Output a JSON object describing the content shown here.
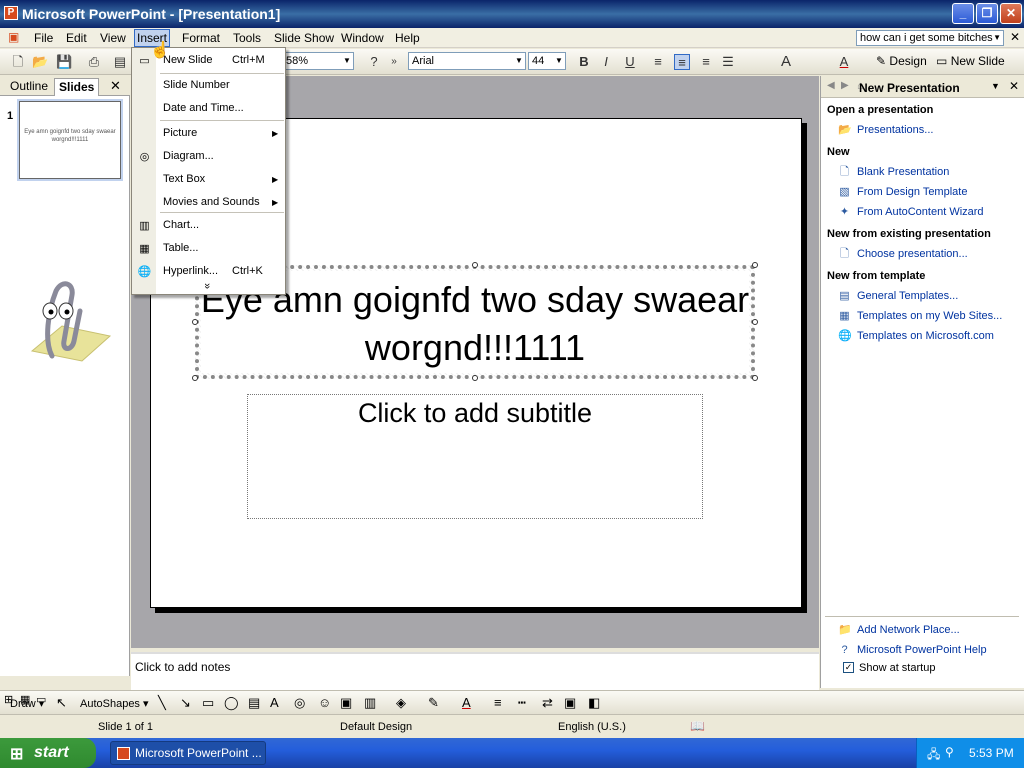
{
  "window": {
    "title": "Microsoft PowerPoint - [Presentation1]",
    "app_icon": "powerpoint-icon"
  },
  "menubar": {
    "items": [
      "File",
      "Edit",
      "View",
      "Insert",
      "Format",
      "Tools",
      "Slide Show",
      "Window",
      "Help"
    ],
    "ask_placeholder": "how can i get some bitches"
  },
  "toolbar": {
    "zoom": "58%",
    "font": "Arial",
    "font_size": "44",
    "design_label": "Design",
    "new_slide_label": "New Slide"
  },
  "insert_menu": {
    "items": [
      {
        "label": "New Slide",
        "shortcut": "Ctrl+M",
        "icon": "new-slide-icon",
        "submenu": false
      },
      {
        "label": "Slide Number",
        "shortcut": "",
        "icon": "",
        "submenu": false
      },
      {
        "label": "Date and Time...",
        "shortcut": "",
        "icon": "",
        "submenu": false
      },
      {
        "label": "Picture",
        "shortcut": "",
        "icon": "",
        "submenu": true
      },
      {
        "label": "Diagram...",
        "shortcut": "",
        "icon": "diagram-icon",
        "submenu": false
      },
      {
        "label": "Text Box",
        "shortcut": "",
        "icon": "",
        "submenu": true
      },
      {
        "label": "Movies and Sounds",
        "shortcut": "",
        "icon": "",
        "submenu": true
      },
      {
        "label": "Chart...",
        "shortcut": "",
        "icon": "chart-icon",
        "submenu": false
      },
      {
        "label": "Table...",
        "shortcut": "",
        "icon": "table-icon",
        "submenu": false
      },
      {
        "label": "Hyperlink...",
        "shortcut": "Ctrl+K",
        "icon": "hyperlink-icon",
        "submenu": false
      }
    ],
    "expand_glyph": "»"
  },
  "left_pane": {
    "tabs": [
      "Outline",
      "Slides"
    ],
    "active_tab": "Slides",
    "slide_number": "1",
    "thumb_text": "Eye amn goignfd two sday swaear worgnd!!!1111"
  },
  "slide": {
    "title": "Eye amn goignfd two sday swaear worgnd!!!1111",
    "subtitle": "Click to add subtitle"
  },
  "notes": {
    "placeholder": "Click to add notes"
  },
  "task_pane": {
    "title": "New Presentation",
    "sections": [
      {
        "header": "Open a presentation",
        "links": [
          {
            "label": "Presentations...",
            "icon": "folder-icon"
          }
        ]
      },
      {
        "header": "New",
        "links": [
          {
            "label": "Blank Presentation",
            "icon": "blank-page-icon"
          },
          {
            "label": "From Design Template",
            "icon": "design-template-icon"
          },
          {
            "label": "From AutoContent Wizard",
            "icon": "wizard-icon"
          }
        ]
      },
      {
        "header": "New from existing presentation",
        "links": [
          {
            "label": "Choose presentation...",
            "icon": "page-icon"
          }
        ]
      },
      {
        "header": "New from template",
        "links": [
          {
            "label": "General Templates...",
            "icon": "template-icon"
          },
          {
            "label": "Templates on my Web Sites...",
            "icon": "web-template-icon"
          },
          {
            "label": "Templates on Microsoft.com",
            "icon": "globe-icon"
          }
        ]
      }
    ],
    "footer_links": [
      {
        "label": "Add Network Place...",
        "icon": "network-folder-icon"
      },
      {
        "label": "Microsoft PowerPoint Help",
        "icon": "help-icon"
      }
    ],
    "show_at_startup": "Show at startup",
    "show_at_startup_checked": true
  },
  "draw_toolbar": {
    "draw_label": "Draw",
    "autoshapes_label": "AutoShapes"
  },
  "status_bar": {
    "slide_of": "Slide 1 of 1",
    "design": "Default Design",
    "language": "English (U.S.)"
  },
  "taskbar": {
    "start_label": "start",
    "task_label": "Microsoft PowerPoint ...",
    "clock": "5:53 PM"
  },
  "colors": {
    "titlebar": "#0a246a",
    "menu_highlight": "#c1d2ee",
    "taskbar": "#245edb",
    "start": "#2f8a2f"
  }
}
